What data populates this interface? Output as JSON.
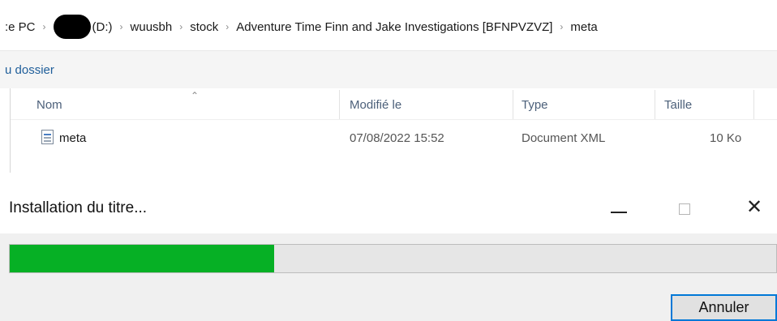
{
  "explorer": {
    "breadcrumb": [
      "Ce PC",
      "(D:)",
      "wuusbh",
      "stock",
      "Adventure Time Finn and Jake Investigations [BFNPVZVZ]",
      "meta"
    ],
    "breadcrumb_visible_first": ":e PC",
    "toolbar_label": "u dossier",
    "columns": {
      "name": "Nom",
      "modified": "Modifié le",
      "type": "Type",
      "size": "Taille"
    },
    "files": [
      {
        "name": "meta",
        "modified": "07/08/2022 15:52",
        "type": "Document XML",
        "size": "10 Ko"
      }
    ]
  },
  "dialog": {
    "title": "Installation du titre...",
    "progress_fraction": 0.345,
    "progress_color": "#06b025",
    "cancel_label": "Annuler",
    "icons": {
      "minimize": "minimize-icon",
      "maximize": "maximize-icon",
      "close": "close-icon"
    }
  }
}
